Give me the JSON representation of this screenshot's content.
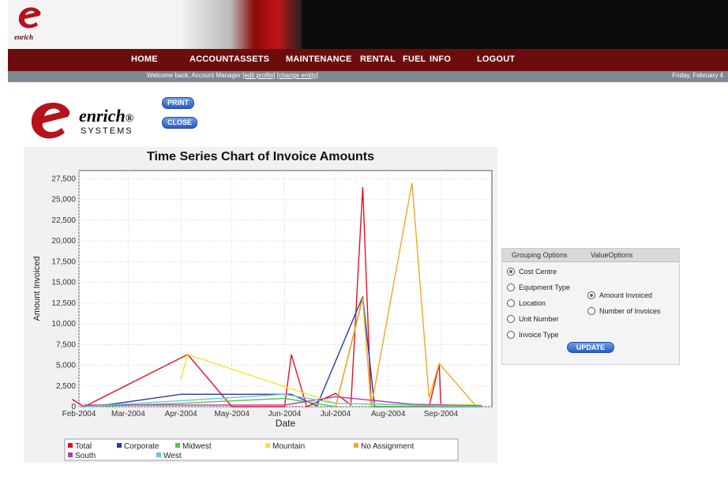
{
  "header": {
    "logo_text": "enrich",
    "nav": [
      "HOME",
      "ACCOUNT",
      "ASSETS",
      "MAINTENANCE",
      "RENTAL",
      "FUEL",
      "INFO",
      "LOGOUT"
    ],
    "welcome_text": "Welcome back,  Account Manager",
    "edit_profile_link": "[edit profile]",
    "change_entity_link": "[change entity]",
    "date_text": "Friday, February 4"
  },
  "brand": {
    "name": "enrich",
    "reg": "®",
    "sub": "SYSTEMS"
  },
  "actions": {
    "print": "PRINT",
    "close": "CLOSE"
  },
  "chart_data": {
    "type": "line",
    "title": "Time Series Chart of Invoice Amounts",
    "xlabel": "Date",
    "ylabel": "Amount Invoiced",
    "x_ticks": [
      "Feb-2004",
      "Mar-2004",
      "Apr-2004",
      "May-2004",
      "Jun-2004",
      "Jul-2004",
      "Aug-2004",
      "Sep-2004"
    ],
    "y_ticks": [
      "0",
      "2,500",
      "5,000",
      "7,500",
      "10,000",
      "12,500",
      "15,000",
      "17,500",
      "20,000",
      "22,500",
      "25,000",
      "27,500"
    ],
    "ylim": [
      0,
      28500
    ],
    "grid": true,
    "legend_position": "bottom",
    "series": [
      {
        "name": "Total",
        "color": "#e8101e",
        "points": [
          [
            "2004-01-28",
            900
          ],
          [
            "2004-02-04",
            0
          ],
          [
            "2004-04-05",
            6300
          ],
          [
            "2004-05-01",
            0
          ],
          [
            "2004-06-01",
            0
          ],
          [
            "2004-06-05",
            6300
          ],
          [
            "2004-06-14",
            0
          ],
          [
            "2004-07-01",
            1600
          ],
          [
            "2004-07-10",
            200
          ],
          [
            "2004-07-17",
            26500
          ],
          [
            "2004-07-22",
            0
          ],
          [
            "2004-08-25",
            0
          ],
          [
            "2004-08-31",
            5100
          ],
          [
            "2004-09-01",
            0
          ],
          [
            "2004-09-25",
            0
          ]
        ]
      },
      {
        "name": "Corporate",
        "color": "#2a3aa8",
        "points": [
          [
            "2004-02-04",
            0
          ],
          [
            "2004-02-20",
            300
          ],
          [
            "2004-04-01",
            1500
          ],
          [
            "2004-06-05",
            1500
          ],
          [
            "2004-06-20",
            100
          ],
          [
            "2004-07-17",
            13300
          ],
          [
            "2004-07-24",
            0
          ],
          [
            "2004-09-25",
            0
          ]
        ]
      },
      {
        "name": "Midwest",
        "color": "#5ec24a",
        "points": [
          [
            "2004-02-04",
            0
          ],
          [
            "2004-04-01",
            400
          ],
          [
            "2004-06-01",
            1000
          ],
          [
            "2004-07-01",
            0
          ],
          [
            "2004-07-17",
            13200
          ],
          [
            "2004-07-22",
            0
          ],
          [
            "2004-09-25",
            0
          ]
        ]
      },
      {
        "name": "Mountain",
        "color": "#f2e52e",
        "points": [
          [
            "2004-04-01",
            3300
          ],
          [
            "2004-04-05",
            6300
          ],
          [
            "2004-07-01",
            400
          ],
          [
            "2004-09-25",
            200
          ]
        ]
      },
      {
        "name": "No Assignment",
        "color": "#f5a623",
        "points": [
          [
            "2004-07-01",
            0
          ],
          [
            "2004-07-17",
            13000
          ],
          [
            "2004-07-22",
            0
          ],
          [
            "2004-08-15",
            27000
          ],
          [
            "2004-08-25",
            1100
          ],
          [
            "2004-08-31",
            5200
          ],
          [
            "2004-09-22",
            0
          ]
        ]
      },
      {
        "name": "South",
        "color": "#b03ab0",
        "points": [
          [
            "2004-02-04",
            200
          ],
          [
            "2004-06-01",
            200
          ],
          [
            "2004-07-01",
            1200
          ],
          [
            "2004-08-15",
            300
          ],
          [
            "2004-09-25",
            100
          ]
        ]
      },
      {
        "name": "West",
        "color": "#66c9d8",
        "points": [
          [
            "2004-02-04",
            0
          ],
          [
            "2004-06-01",
            1500
          ],
          [
            "2004-07-01",
            400
          ],
          [
            "2004-09-25",
            0
          ]
        ]
      }
    ]
  },
  "options": {
    "tab_grouping": "Grouping Options",
    "tab_value": "ValueOptions",
    "grouping": [
      {
        "label": "Cost Centre",
        "checked": true
      },
      {
        "label": "Equipment Type",
        "checked": false
      },
      {
        "label": "Location",
        "checked": false
      },
      {
        "label": "Unit Number",
        "checked": false
      },
      {
        "label": "Invoice Type",
        "checked": false
      }
    ],
    "value": [
      {
        "label": "Amount Invoiced",
        "checked": true
      },
      {
        "label": "Number of Invoices",
        "checked": false
      }
    ],
    "update": "UPDATE"
  }
}
